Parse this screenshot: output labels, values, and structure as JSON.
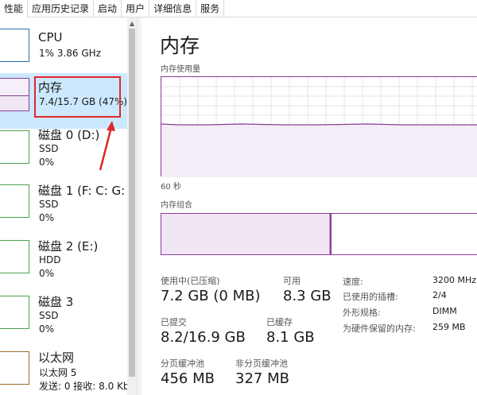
{
  "tabs": [
    "性能",
    "应用历史记录",
    "启动",
    "用户",
    "详细信息",
    "服务"
  ],
  "sidebar": {
    "cpu": {
      "title": "CPU",
      "sub": "1% 3.86 GHz"
    },
    "memory": {
      "title": "内存",
      "sub": "7.4/15.7 GB (47%)",
      "usage_fraction": 0.47
    },
    "disk0": {
      "title": "磁盘 0 (D:)",
      "type": "SSD",
      "usage": "0%"
    },
    "disk1": {
      "title": "磁盘 1 (F: C: G:",
      "type": "SSD",
      "usage": "0%"
    },
    "disk2": {
      "title": "磁盘 2 (E:)",
      "type": "HDD",
      "usage": "0%"
    },
    "disk3": {
      "title": "磁盘 3",
      "type": "SSD",
      "usage": "0%"
    },
    "ethernet": {
      "title": "以太网",
      "sub": "以太网 5",
      "rates": "发送: 0 接收: 8.0 Kb"
    }
  },
  "main": {
    "title": "内存",
    "usage_label": "内存使用量",
    "time_label": "60 秒",
    "composition_label": "内存组合",
    "composition_used_fraction": 0.52,
    "stats": {
      "in_use_label": "使用中(已压缩)",
      "in_use_value": "7.2 GB (0 MB)",
      "available_label": "可用",
      "available_value": "8.3 GB",
      "committed_label": "已提交",
      "committed_value": "8.2/16.9 GB",
      "cached_label": "已缓存",
      "cached_value": "8.1 GB",
      "paged_label": "分页缓冲池",
      "paged_value": "456 MB",
      "nonpaged_label": "非分页缓冲池",
      "nonpaged_value": "327 MB"
    },
    "details": [
      {
        "label": "速度:",
        "value": "3200 MHz"
      },
      {
        "label": "已使用的插槽:",
        "value": "2/4"
      },
      {
        "label": "外形规格:",
        "value": "DIMM"
      },
      {
        "label": "为硬件保留的内存:",
        "value": "259 MB"
      }
    ]
  },
  "colors": {
    "memory_accent": "#8b3d96",
    "selected_bg": "#cce8ff",
    "annotation_red": "#e0282a"
  }
}
